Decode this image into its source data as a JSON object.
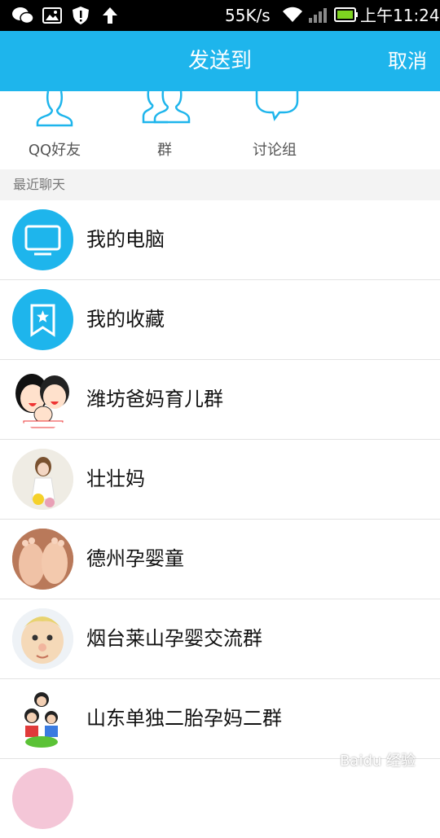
{
  "status_bar": {
    "speed": "55K/s",
    "time": "上午11:24",
    "icons": [
      "wechat-icon",
      "image-icon",
      "shield-icon",
      "upload-arrow-icon",
      "wifi-icon",
      "signal-icon",
      "battery-icon"
    ]
  },
  "header": {
    "title": "发送到",
    "cancel_label": "取消",
    "color": "#1eb5ec"
  },
  "categories": [
    {
      "label": "QQ好友",
      "icon": "person-icon"
    },
    {
      "label": "群",
      "icon": "group-icon"
    },
    {
      "label": "讨论组",
      "icon": "discussion-icon"
    }
  ],
  "section": {
    "label": "最近聊天"
  },
  "recent_chats": [
    {
      "name": "我的电脑",
      "avatar": "computer-icon"
    },
    {
      "name": "我的收藏",
      "avatar": "bookmark-star-icon"
    },
    {
      "name": "潍坊爸妈育儿群",
      "avatar": "cartoon-family-avatar"
    },
    {
      "name": "壮壮妈",
      "avatar": "photo-avatar"
    },
    {
      "name": "德州孕婴童",
      "avatar": "baby-feet-avatar"
    },
    {
      "name": "烟台莱山孕婴交流群",
      "avatar": "doll-avatar"
    },
    {
      "name": "山东单独二胎孕妈二群",
      "avatar": "family-photo-avatar"
    }
  ],
  "watermark": "Baidu 经验"
}
